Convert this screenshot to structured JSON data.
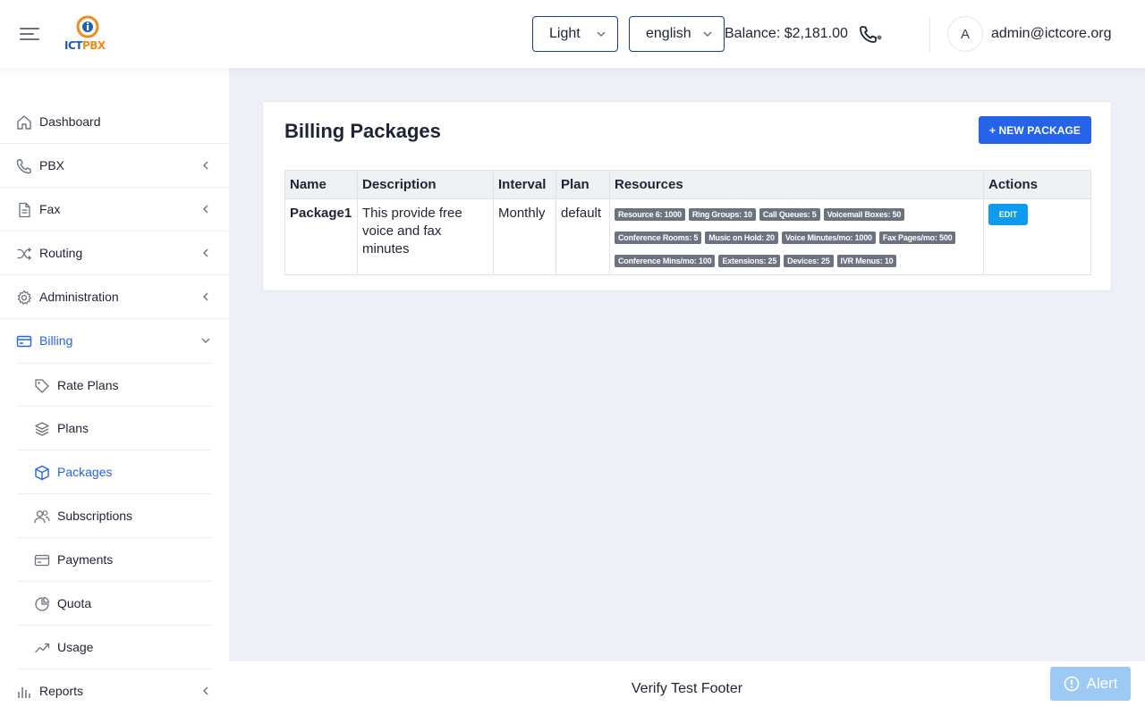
{
  "header": {
    "logo_text_1": "ICT",
    "logo_text_2": "PBX",
    "theme_select": "Light",
    "language_select": "english",
    "balance": "Balance: $2,181.00",
    "avatar_initial": "A",
    "user_email": "admin@ictcore.org"
  },
  "sidebar": {
    "items": [
      {
        "label": "Dashboard",
        "icon": "home-icon"
      },
      {
        "label": "PBX",
        "icon": "phone-icon"
      },
      {
        "label": "Fax",
        "icon": "document-icon"
      },
      {
        "label": "Routing",
        "icon": "shuffle-icon"
      },
      {
        "label": "Administration",
        "icon": "gear-icon"
      },
      {
        "label": "Billing",
        "icon": "credit-card-icon"
      },
      {
        "label": "Reports",
        "icon": "bar-chart-icon"
      }
    ],
    "billing_sub": [
      {
        "label": "Rate Plans",
        "icon": "tag-icon"
      },
      {
        "label": "Plans",
        "icon": "layers-icon"
      },
      {
        "label": "Packages",
        "icon": "box-icon"
      },
      {
        "label": "Subscriptions",
        "icon": "users-icon"
      },
      {
        "label": "Payments",
        "icon": "credit-card-icon"
      },
      {
        "label": "Quota",
        "icon": "pie-chart-icon"
      },
      {
        "label": "Usage",
        "icon": "trending-up-icon"
      }
    ]
  },
  "main": {
    "title": "Billing Packages",
    "new_button": "+ NEW PACKAGE",
    "table": {
      "headers": [
        "Name",
        "Description",
        "Interval",
        "Plan",
        "Resources",
        "Actions"
      ],
      "rows": [
        {
          "name": "Package1",
          "description": "This provide free voice and fax minutes",
          "interval": "Monthly",
          "plan": "default",
          "resources": [
            "Resource 6: 1000",
            "Ring Groups: 10",
            "Call Queues: 5",
            "Voicemail Boxes: 50",
            "Conference Rooms: 5",
            "Music on Hold: 20",
            "Voice Minutes/mo: 1000",
            "Fax Pages/mo: 500",
            "Conference Mins/mo: 100",
            "Extensions: 25",
            "Devices: 25",
            "IVR Menus: 10"
          ],
          "action": "EDIT"
        }
      ]
    }
  },
  "footer": {
    "text": "Verify Test Footer",
    "alert": "Alert"
  },
  "colors": {
    "accent": "#2563eb",
    "edit_button": "#0d9bf2",
    "badge": "#6b7280",
    "alert": "#9ccaf5"
  }
}
